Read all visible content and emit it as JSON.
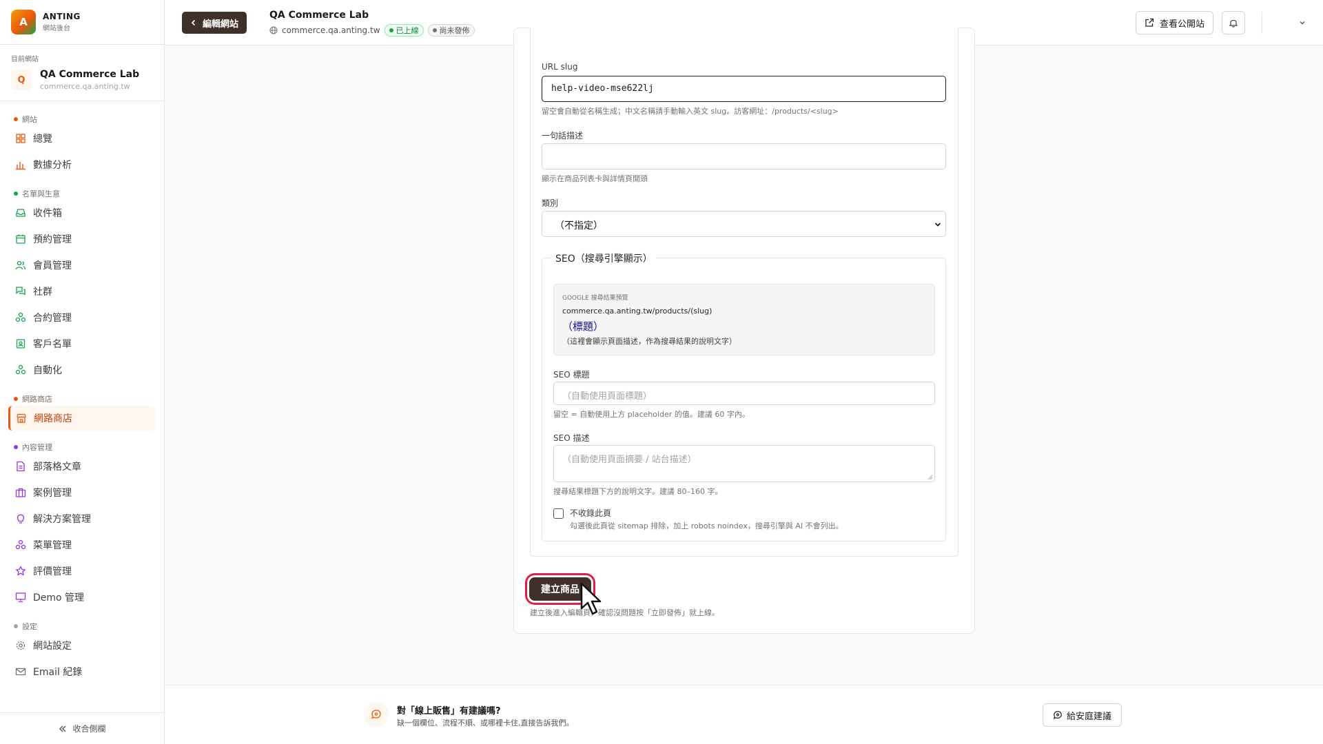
{
  "brand": {
    "logo_letter": "A",
    "name": "ANTING",
    "sub": "網站後台"
  },
  "current_site": {
    "label": "目前網站",
    "avatar_letter": "Q",
    "name": "QA Commerce Lab",
    "domain": "commerce.qa.anting.tw"
  },
  "nav": {
    "sections": [
      {
        "title": "網站",
        "color": "#ea580c",
        "items": [
          {
            "label": "總覽",
            "icon": "grid-icon"
          },
          {
            "label": "數據分析",
            "icon": "bar-chart-icon"
          }
        ]
      },
      {
        "title": "名單與生意",
        "color": "#16a34a",
        "items": [
          {
            "label": "收件箱",
            "icon": "inbox-icon"
          },
          {
            "label": "預約管理",
            "icon": "calendar-icon"
          },
          {
            "label": "會員管理",
            "icon": "users-icon"
          },
          {
            "label": "社群",
            "icon": "chat-icon"
          },
          {
            "label": "合約管理",
            "icon": "cluster-icon"
          },
          {
            "label": "客戶名單",
            "icon": "contact-icon"
          },
          {
            "label": "自動化",
            "icon": "cluster-icon"
          }
        ]
      },
      {
        "title": "網路商店",
        "color": "#ea580c",
        "items": [
          {
            "label": "網路商店",
            "icon": "store-icon",
            "active": true
          }
        ]
      },
      {
        "title": "內容管理",
        "color": "#9333ea",
        "items": [
          {
            "label": "部落格文章",
            "icon": "document-icon"
          },
          {
            "label": "案例管理",
            "icon": "briefcase-icon"
          },
          {
            "label": "解決方案管理",
            "icon": "lightbulb-icon"
          },
          {
            "label": "菜單管理",
            "icon": "cluster-icon"
          },
          {
            "label": "評價管理",
            "icon": "star-icon"
          },
          {
            "label": "Demo 管理",
            "icon": "presentation-icon"
          }
        ]
      },
      {
        "title": "設定",
        "color": "#a8a29e",
        "items": [
          {
            "label": "網站設定",
            "icon": "gear-icon"
          },
          {
            "label": "Email 紀錄",
            "icon": "mail-icon"
          }
        ]
      }
    ],
    "collapse_label": "收合側欄"
  },
  "topbar": {
    "back_label": "編輯網站",
    "site_title": "QA Commerce Lab",
    "site_domain": "commerce.qa.anting.tw",
    "badge_live": "已上線",
    "badge_draft": "尚未發佈",
    "view_site_label": "查看公開站"
  },
  "form": {
    "slug_label": "URL slug",
    "slug_value": "help-video-mse622lj",
    "slug_hint": "留空會自動從名稱生成；中文名稱請手動輸入英文 slug。訪客網址：/products/<slug>",
    "tagline_label": "一句話描述",
    "tagline_value": "",
    "tagline_hint": "顯示在商品列表卡與詳情頁開頭",
    "category_label": "類別",
    "category_value": "（不指定）",
    "seo": {
      "legend": "SEO（搜尋引擎顯示）",
      "preview_label": "GOOGLE 搜尋結果預覽",
      "preview_url": "commerce.qa.anting.tw/products/(slug)",
      "preview_title": "（標題）",
      "preview_desc": "（這裡會顯示頁面描述，作為搜尋結果的說明文字）",
      "title_label": "SEO 標題",
      "title_placeholder": "（自動使用頁面標題）",
      "title_hint": "留空 = 自動使用上方 placeholder 的值。建議 60 字內。",
      "desc_label": "SEO 描述",
      "desc_placeholder": "（自動使用頁面摘要 / 站台描述）",
      "desc_hint": "搜尋結果標題下方的說明文字。建議 80–160 字。",
      "noindex_label": "不收錄此頁",
      "noindex_hint": "勾選後此頁從 sitemap 排除，加上 robots noindex，搜尋引擎與 AI 不會列出。"
    },
    "submit_label": "建立商品",
    "submit_hint": "建立後進入編輯頁，確認沒問題按「立即發佈」就上線。"
  },
  "footer": {
    "title": "對「線上販售」有建議嗎?",
    "subtitle": "缺一個欄位、流程不順、或哪裡卡住,直接告訴我們。",
    "button_label": "給安庭建議"
  },
  "colors": {
    "accent": "#ea580c",
    "primary_dark": "#3f302a",
    "highlight_ring": "#e11d48",
    "link_blue": "#1a0dab"
  }
}
